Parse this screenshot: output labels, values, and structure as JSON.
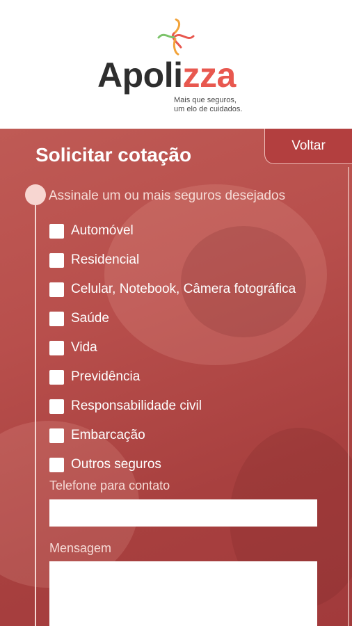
{
  "brand": {
    "name_main": "Apoli",
    "name_accent": "zza",
    "tagline_line1": "Mais que seguros,",
    "tagline_line2": "um elo de cuidados."
  },
  "form": {
    "title": "Solicitar cotação",
    "back_label": "Voltar",
    "question": "Assinale um ou mais seguros desejados",
    "options": [
      {
        "label": "Automóvel",
        "checked": false
      },
      {
        "label": "Residencial",
        "checked": false
      },
      {
        "label": "Celular, Notebook, Câmera fotográfica",
        "checked": false
      },
      {
        "label": "Saúde",
        "checked": false
      },
      {
        "label": "Vida",
        "checked": false
      },
      {
        "label": "Previdência",
        "checked": false
      },
      {
        "label": "Responsabilidade civil",
        "checked": false
      },
      {
        "label": "Embarcação",
        "checked": false
      },
      {
        "label": "Outros seguros",
        "checked": false
      }
    ],
    "phone_label": "Telefone para contato",
    "phone_value": "",
    "message_label": "Mensagem",
    "message_value": ""
  },
  "colors": {
    "accent": "#e8584f",
    "panel": "#b84f4c",
    "button": "#b33f3f"
  }
}
